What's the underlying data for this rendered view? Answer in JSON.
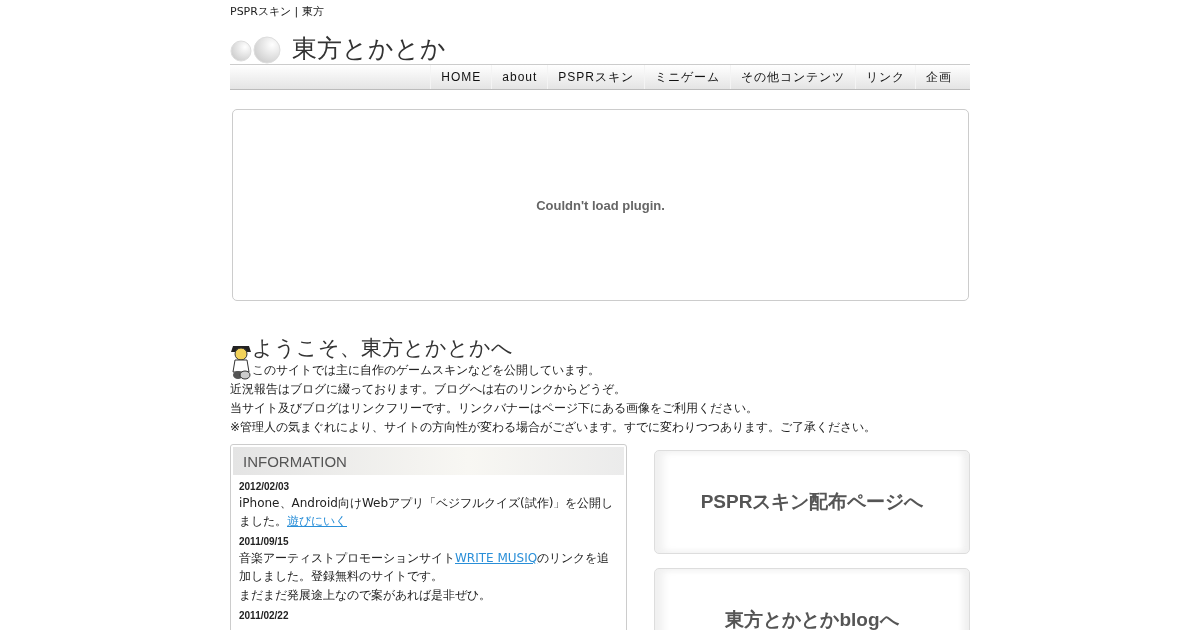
{
  "top_caption": "PSPRスキン | 東方",
  "site_title": "東方とかとか",
  "nav": [
    {
      "label": "HOME"
    },
    {
      "label": "about"
    },
    {
      "label": "PSPRスキン"
    },
    {
      "label": "ミニゲーム"
    },
    {
      "label": "その他コンテンツ"
    },
    {
      "label": "リンク"
    },
    {
      "label": "企画"
    }
  ],
  "plugin_message": "Couldn't load plugin.",
  "welcome": {
    "heading": "ようこそ、東方とかとかへ",
    "lines": [
      "このサイトでは主に自作のゲームスキンなどを公開しています。",
      "近況報告はブログに綴っております。ブログへは右のリンクからどうぞ。",
      "当サイト及びブログはリンクフリーです。リンクバナーはページ下にある画像をご利用ください。",
      "※管理人の気まぐれにより、サイトの方向性が変わる場合がございます。すでに変わりつつあります。ご了承ください。"
    ]
  },
  "information": {
    "title": "INFORMATION",
    "entries": [
      {
        "date": "2012/02/03",
        "lines": [
          [
            {
              "kind": "text",
              "text": "iPhone、Android向けWebアプリ「ベジフルクイズ(試作)」を公開しました。"
            },
            {
              "kind": "link",
              "text": "遊びにいく"
            }
          ]
        ]
      },
      {
        "date": "2011/09/15",
        "lines": [
          [
            {
              "kind": "text",
              "text": "音楽アーティストプロモーションサイト"
            },
            {
              "kind": "link",
              "text": "WRITE MUSIQ"
            },
            {
              "kind": "text",
              "text": "のリンクを追加しました。登録無料のサイトです。"
            }
          ],
          [
            {
              "kind": "text",
              "text": "まだまだ発展途上なので案があれば是非ぜひ。"
            }
          ]
        ]
      },
      {
        "date": "2011/02/22"
      }
    ]
  },
  "banners": [
    {
      "label": "PSPRスキン配布ページへ"
    },
    {
      "label": "東方とかとかblogへ"
    }
  ]
}
